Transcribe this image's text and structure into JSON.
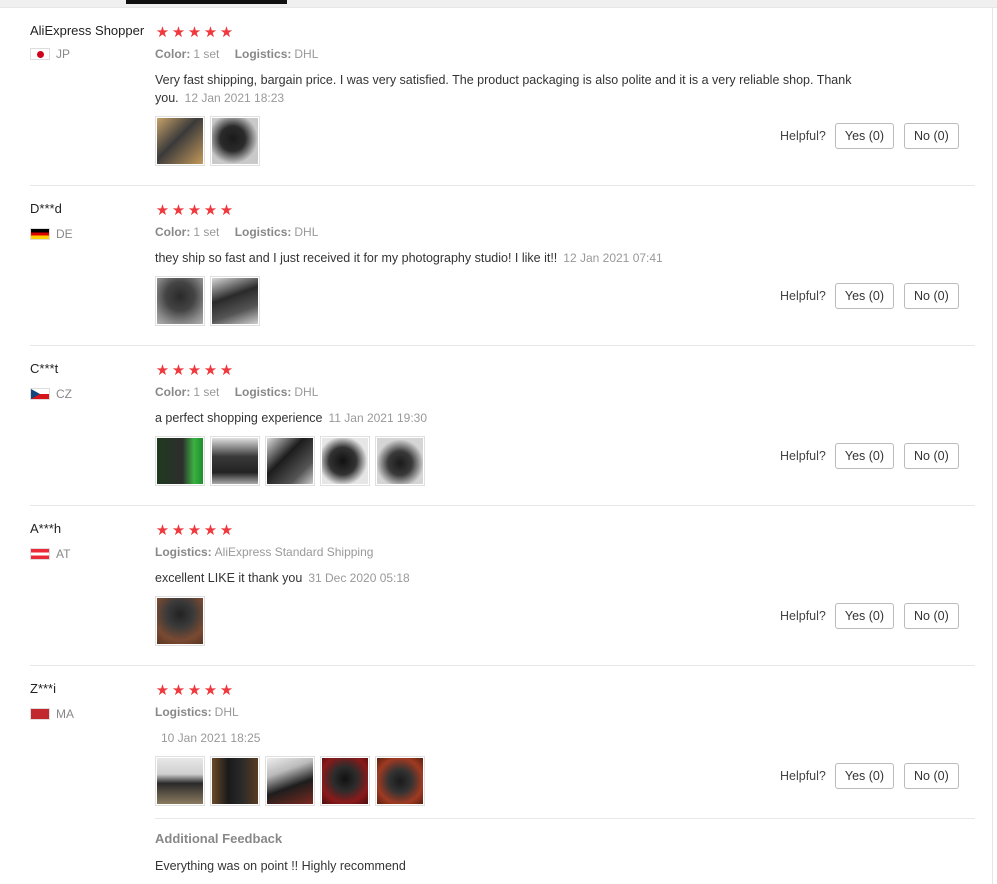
{
  "reviews": [
    {
      "user": "AliExpress Shopper",
      "country": "JP",
      "stars": 5,
      "color_label": "Color:",
      "color_value": "1 set",
      "logistics_label": "Logistics:",
      "logistics_value": "DHL",
      "text": "Very fast shipping, bargain price. I was very satisfied. The product packaging is also polite and it is a very reliable shop. Thank you.",
      "date": "12 Jan 2021 18:23",
      "photos": 2,
      "helpful_label": "Helpful?",
      "yes_label": "Yes (0)",
      "no_label": "No (0)"
    },
    {
      "user": "D***d",
      "country": "DE",
      "stars": 5,
      "color_label": "Color:",
      "color_value": "1 set",
      "logistics_label": "Logistics:",
      "logistics_value": "DHL",
      "text": "they ship so fast and I just received it for my photography studio! I like it!!",
      "date": "12 Jan 2021 07:41",
      "photos": 2,
      "helpful_label": "Helpful?",
      "yes_label": "Yes (0)",
      "no_label": "No (0)"
    },
    {
      "user": "C***t",
      "country": "CZ",
      "stars": 5,
      "color_label": "Color:",
      "color_value": "1 set",
      "logistics_label": "Logistics:",
      "logistics_value": "DHL",
      "text": "a perfect shopping experience",
      "date": "11 Jan 2021 19:30",
      "photos": 5,
      "helpful_label": "Helpful?",
      "yes_label": "Yes (0)",
      "no_label": "No (0)"
    },
    {
      "user": "A***h",
      "country": "AT",
      "stars": 5,
      "logistics_label": "Logistics:",
      "logistics_value": "AliExpress Standard Shipping",
      "text": "excellent LIKE it thank you",
      "date": "31 Dec 2020 05:18",
      "photos": 1,
      "helpful_label": "Helpful?",
      "yes_label": "Yes (0)",
      "no_label": "No (0)"
    },
    {
      "user": "Z***i",
      "country": "MA",
      "stars": 5,
      "logistics_label": "Logistics:",
      "logistics_value": "DHL",
      "text": "",
      "date": "10 Jan 2021 18:25",
      "photos": 5,
      "helpful_label": "Helpful?",
      "yes_label": "Yes (0)",
      "no_label": "No (0)"
    }
  ],
  "additional_feedback": {
    "title": "Additional Feedback",
    "text": "Everything was on point !! Highly recommend"
  },
  "colors": {
    "star": "#f0393f",
    "muted": "#999999",
    "text": "#333333"
  }
}
